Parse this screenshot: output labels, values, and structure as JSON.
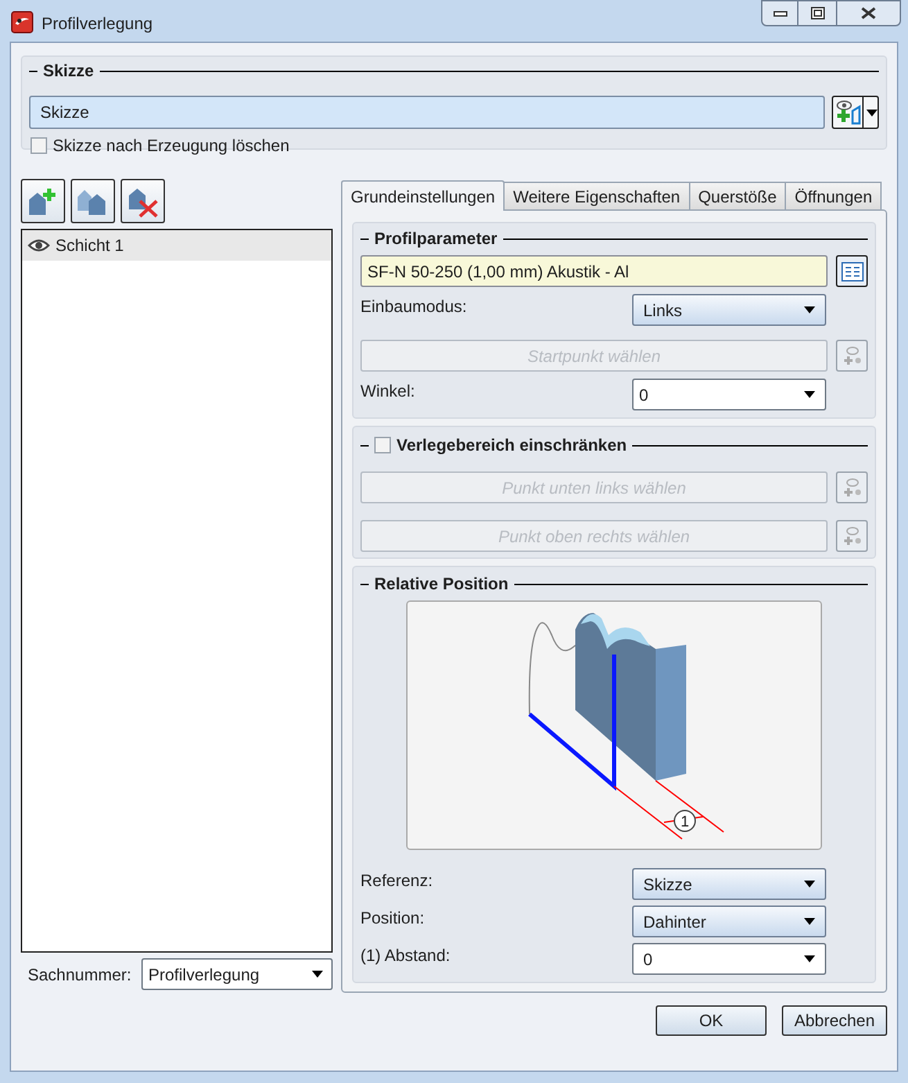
{
  "window": {
    "title": "Profilverlegung"
  },
  "skizze": {
    "title": "Skizze",
    "value": "Skizze",
    "delete_checkbox": {
      "label": "Skizze nach Erzeugung löschen",
      "checked": false
    }
  },
  "layers": [
    {
      "name": "Schicht 1",
      "visible": true,
      "selected": true
    }
  ],
  "sachnummer": {
    "label": "Sachnummer:",
    "value": "Profilverlegung"
  },
  "tabs": [
    {
      "label": "Grundeinstellungen",
      "selected": true
    },
    {
      "label": "Weitere Eigenschaften",
      "selected": false
    },
    {
      "label": "Querstöße",
      "selected": false
    },
    {
      "label": "Öffnungen",
      "selected": false
    }
  ],
  "profilparameter": {
    "title": "Profilparameter",
    "value": "SF-N 50-250 (1,00 mm) Akustik - Al",
    "einbaumodus": {
      "label": "Einbaumodus:",
      "value": "Links"
    },
    "startpunkt": {
      "label": "Startpunkt wählen",
      "disabled": true
    },
    "winkel": {
      "label": "Winkel:",
      "value": "0"
    }
  },
  "verlegebereich": {
    "title": "Verlegebereich einschränken",
    "checked": false,
    "buttons": [
      {
        "label": "Punkt unten links wählen",
        "disabled": true
      },
      {
        "label": "Punkt oben rechts wählen",
        "disabled": true
      }
    ]
  },
  "relative_position": {
    "title": "Relative Position",
    "callout": "1",
    "referenz": {
      "label": "Referenz:",
      "value": "Skizze"
    },
    "position": {
      "label": "Position:",
      "value": "Dahinter"
    },
    "abstand": {
      "label": "(1) Abstand:",
      "value": "0"
    }
  },
  "buttons": [
    "OK",
    "Abbrechen"
  ]
}
